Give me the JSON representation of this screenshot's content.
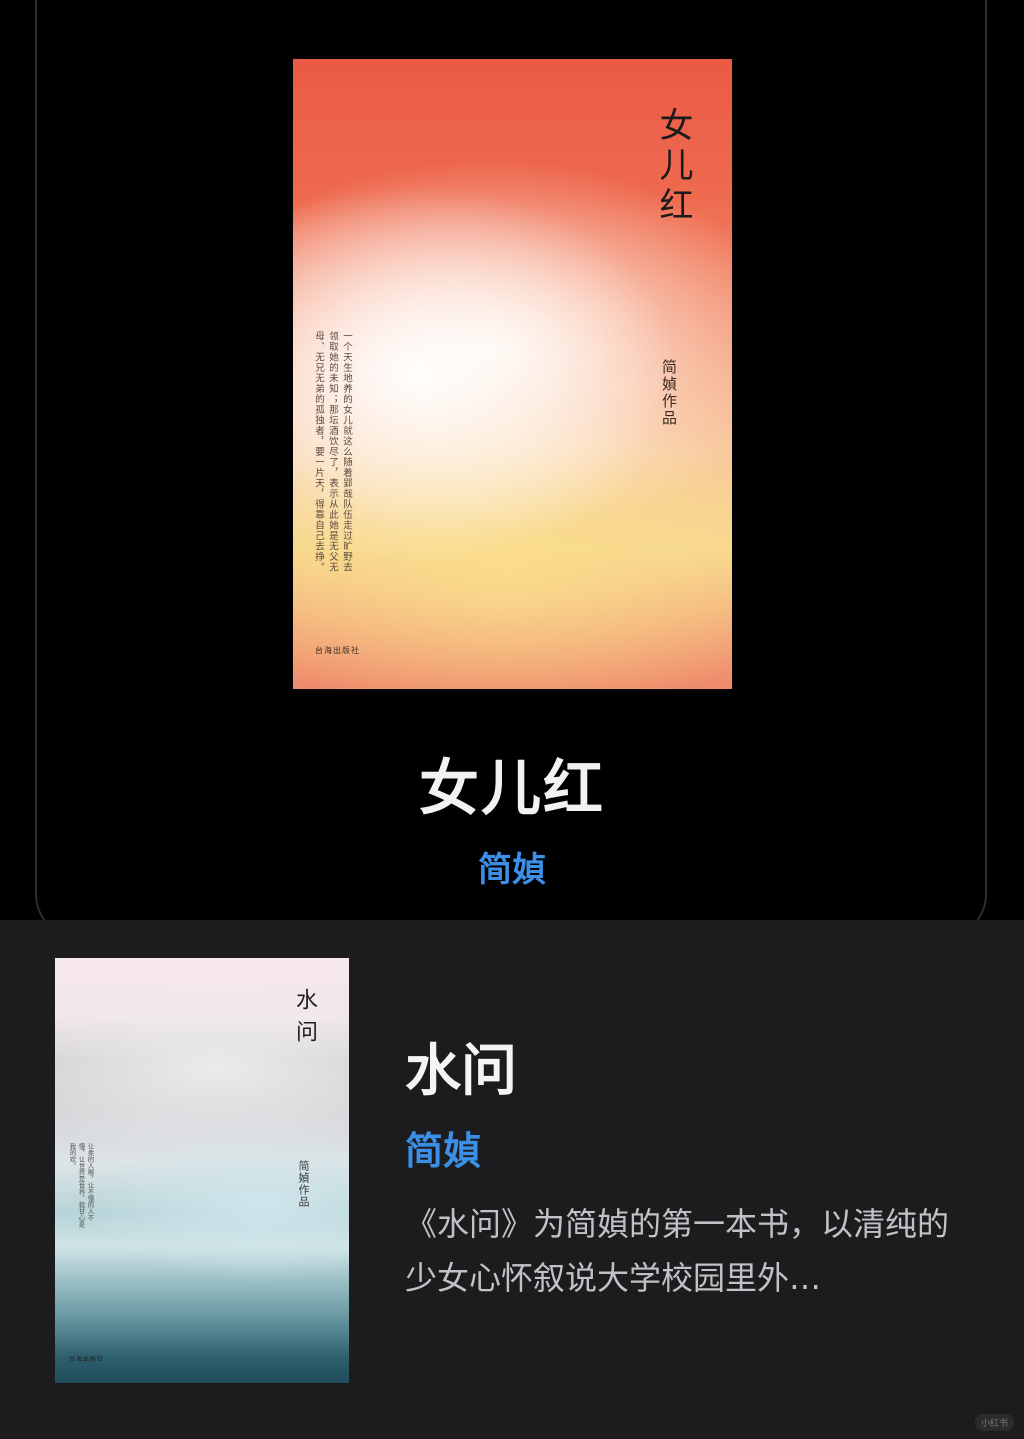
{
  "featured": {
    "cover": {
      "title": "女儿红",
      "author_line": "简媜作品",
      "blurb": "一个天生地养的女儿就这么随着郢哉队伍走过旷野去领取她的未知；那坛酒饮尽了，表示从此她是无父无母、无兄无弟的孤独者，要一片天，得靠自己去挣。",
      "publisher": "台海出版社"
    },
    "title": "女儿红",
    "author": "简媜"
  },
  "list_item": {
    "cover": {
      "title": "水问",
      "author_line": "简媜作品",
      "blurb": "让柔的人哪，让不懂的人不懂，让世界是世界，我甘心是我的欢。",
      "publisher": "台海出版社"
    },
    "title": "水问",
    "author": "简媜",
    "description": "《水问》为简媜的第一本书，以清纯的少女心怀叙说大学校园里外…"
  },
  "watermark": "小红书",
  "colors": {
    "background": "#000000",
    "card": "#1c1c1e",
    "accent_blue": "#3b8fe6",
    "title_text": "#f2f2f2",
    "desc_text": "#c2c2c6"
  }
}
